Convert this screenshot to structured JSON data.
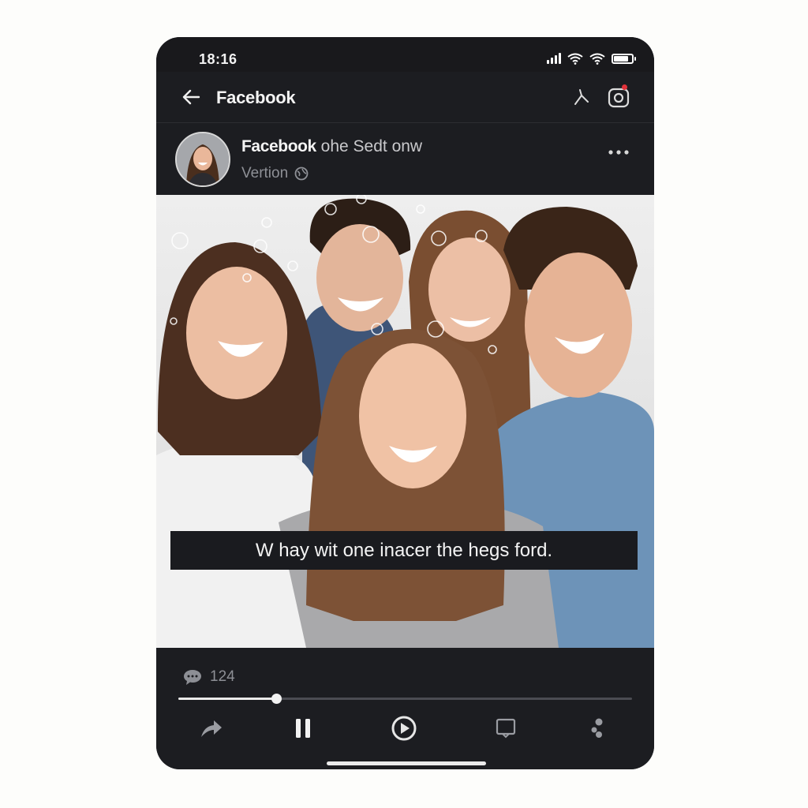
{
  "status_bar": {
    "time": "18:16",
    "battery_level": 0.85
  },
  "nav": {
    "title": "Facebook"
  },
  "post": {
    "author_bold": "Facebook",
    "author_rest": "ohe Sedt onw",
    "subtitle": "Vertion",
    "caption": "W hay wit one inacer the hegs ford."
  },
  "player": {
    "comment_count": "124",
    "progress_fraction": 0.215
  },
  "colors": {
    "background": "#fdfdfb",
    "phone": "#1c1d21",
    "notification_dot": "#e0323a"
  },
  "icons": {
    "back": "arrow-left-icon",
    "nav_action_1": "share-icon",
    "nav_action_2": "camera-icon",
    "more": "more-horizontal-icon",
    "comment": "comment-bubble-icon",
    "share": "share-arrow-icon",
    "pause": "pause-icon",
    "play": "play-circle-icon",
    "captions": "captions-icon",
    "people": "people-icon",
    "globe": "globe-icon"
  }
}
